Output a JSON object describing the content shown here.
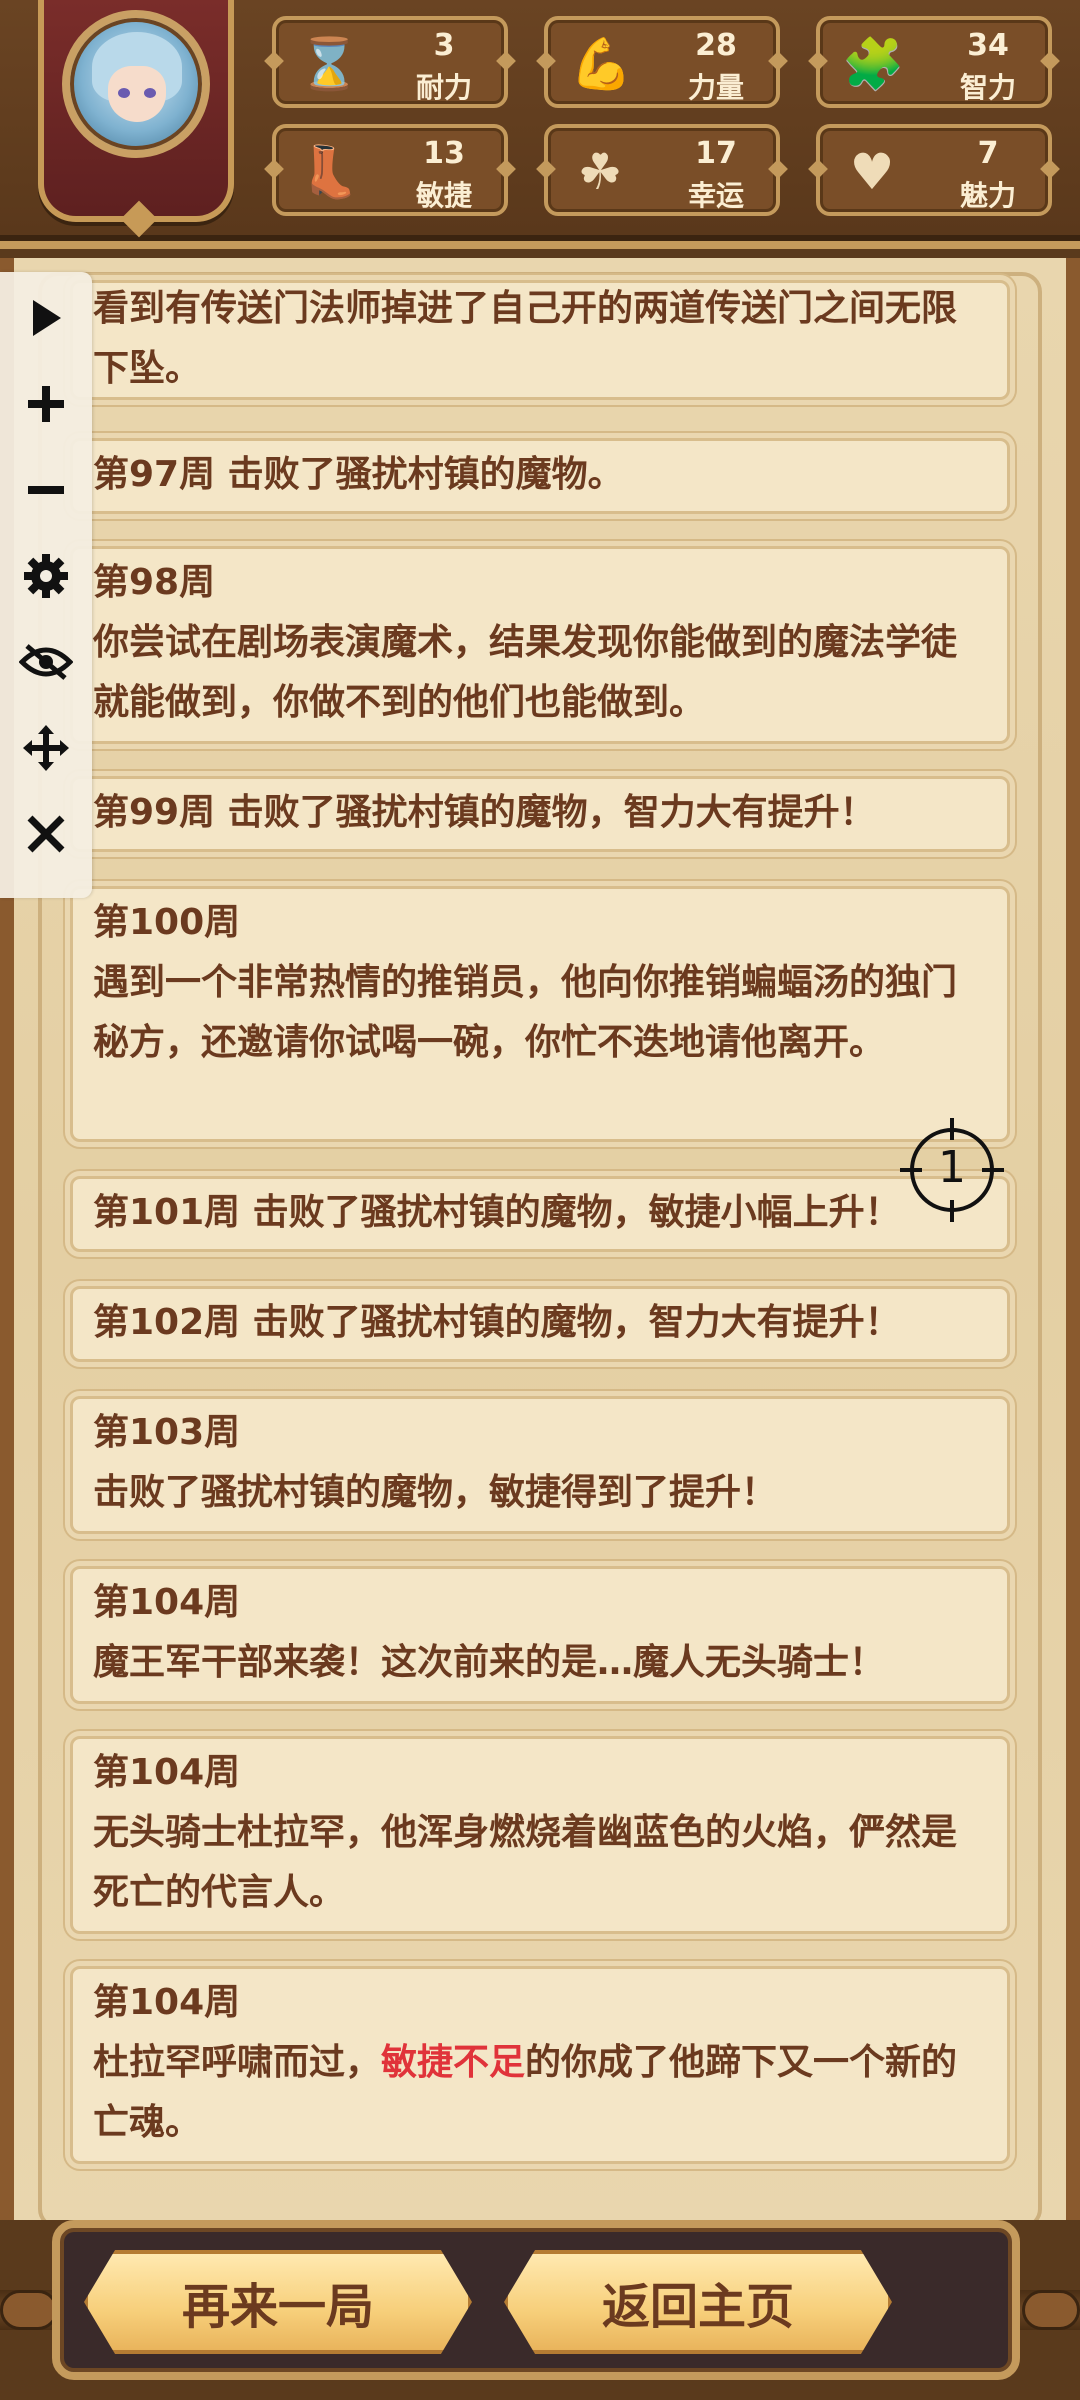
{
  "stats": [
    {
      "icon": "hourglass-icon",
      "value": "3",
      "label": "耐力"
    },
    {
      "icon": "muscle-icon",
      "value": "28",
      "label": "力量"
    },
    {
      "icon": "puzzle-icon",
      "value": "34",
      "label": "智力"
    },
    {
      "icon": "boot-icon",
      "value": "13",
      "label": "敏捷"
    },
    {
      "icon": "clover-icon",
      "value": "17",
      "label": "幸运"
    },
    {
      "icon": "heart-plus-icon",
      "value": "7",
      "label": "魅力"
    }
  ],
  "log": [
    {
      "text": "看到有传送门法师掉进了自己开的两道传送门之间无限下坠。"
    },
    {
      "text": "第97周 击败了骚扰村镇的魔物。"
    },
    {
      "week": "第98周",
      "text": "你尝试在剧场表演魔术，结果发现你能做到的魔法学徒就能做到，你做不到的他们也能做到。"
    },
    {
      "text": "第99周 击败了骚扰村镇的魔物，智力大有提升！"
    },
    {
      "week": "第100周",
      "text": "遇到一个非常热情的推销员，他向你推销蝙蝠汤的独门秘方，还邀请你试喝一碗，你忙不迭地请他离开。"
    },
    {
      "text": "第101周 击败了骚扰村镇的魔物，敏捷小幅上升！"
    },
    {
      "text": "第102周 击败了骚扰村镇的魔物，智力大有提升！"
    },
    {
      "week": "第103周",
      "text": "击败了骚扰村镇的魔物，敏捷得到了提升！"
    },
    {
      "week": "第104周",
      "text": "魔王军干部来袭！这次前来的是…魔人无头骑士！"
    },
    {
      "week": "第104周",
      "text": "无头骑士杜拉罕，他浑身燃烧着幽蓝色的火焰，俨然是死亡的代言人。"
    },
    {
      "week": "第104周",
      "text_a": "杜拉罕呼啸而过，",
      "text_red": "敏捷不足",
      "text_b": "的你成了他蹄下又一个新的亡魂。"
    }
  ],
  "toolbar": [
    "play-icon",
    "plus-icon",
    "minus-icon",
    "gear-icon",
    "eye-off-icon",
    "move-icon",
    "close-icon"
  ],
  "crosshair_label": "1",
  "buttons": {
    "again": "再来一局",
    "home": "返回主页"
  }
}
